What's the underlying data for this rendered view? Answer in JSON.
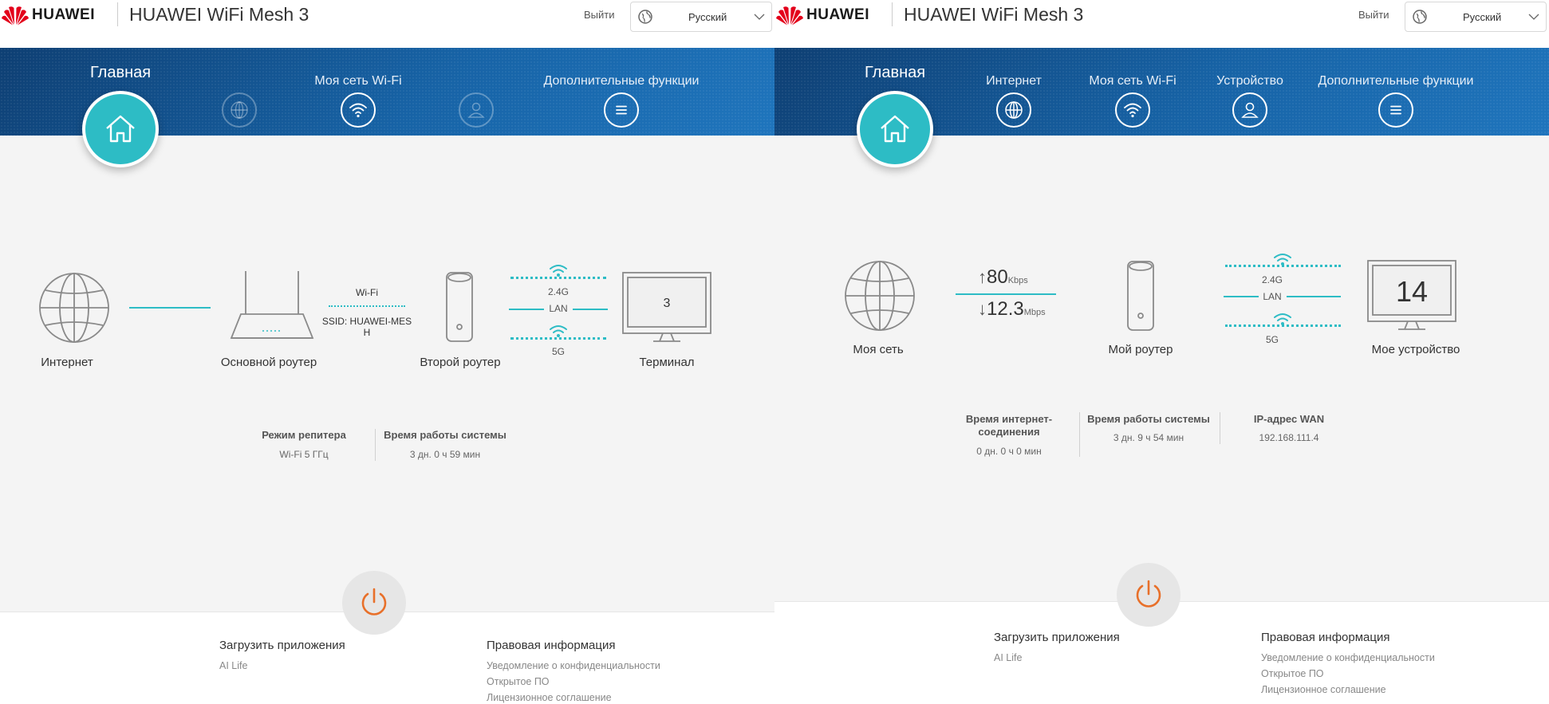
{
  "left": {
    "header": {
      "brand": "HUAWEI",
      "title": "HUAWEI WiFi Mesh 3",
      "logout": "Выйти",
      "language": "Русский"
    },
    "nav": {
      "home": "Главная",
      "wifi": "Моя сеть Wi-Fi",
      "more": "Дополнительные функции"
    },
    "topology": {
      "internet": "Интернет",
      "main_router": "Основной роутер",
      "wifi_label": "Wi-Fi",
      "ssid": "SSID: HUAWEI-MESH",
      "second_router": "Второй роутер",
      "band_24": "2.4G",
      "lan": "LAN",
      "band_5": "5G",
      "terminal": "Терминал",
      "terminal_count": "3"
    },
    "stats": [
      {
        "title": "Режим репитера",
        "value": "Wi-Fi 5 ГГц"
      },
      {
        "title": "Время работы системы",
        "value": "3 дн. 0 ч 59 мин"
      }
    ],
    "footer": {
      "apps_title": "Загрузить приложения",
      "apps_link": "AI Life",
      "legal_title": "Правовая информация",
      "legal_links": [
        "Уведомление о конфиденциальности",
        "Открытое ПО",
        "Лицензионное соглашение"
      ]
    }
  },
  "right": {
    "header": {
      "brand": "HUAWEI",
      "title": "HUAWEI WiFi Mesh 3",
      "logout": "Выйти",
      "language": "Русский"
    },
    "nav": {
      "home": "Главная",
      "internet": "Интернет",
      "wifi": "Моя сеть Wi-Fi",
      "device": "Устройство",
      "more": "Дополнительные функции"
    },
    "topology": {
      "my_network": "Моя сеть",
      "upload_value": "80",
      "upload_unit": "Kbps",
      "download_value": "12.3",
      "download_unit": "Mbps",
      "my_router": "Мой роутер",
      "band_24": "2.4G",
      "lan": "LAN",
      "band_5": "5G",
      "my_device": "Мое устройство",
      "device_count": "14"
    },
    "stats": [
      {
        "title_line1": "Время интернет-",
        "title_line2": "соединения",
        "value": "0 дн. 0 ч 0 мин"
      },
      {
        "title": "Время работы системы",
        "value": "3 дн. 9 ч 54 мин"
      },
      {
        "title": "IP-адрес WAN",
        "value": "192.168.111.4"
      }
    ],
    "footer": {
      "apps_title": "Загрузить приложения",
      "apps_link": "AI Life",
      "legal_title": "Правовая информация",
      "legal_links": [
        "Уведомление о конфиденциальности",
        "Открытое ПО",
        "Лицензионное соглашение"
      ]
    }
  },
  "colors": {
    "accent": "#2dbcc5",
    "nav_dark": "#0e3f73",
    "nav_light": "#1f75bd",
    "power": "#e8702a",
    "brand_red": "#e3001b"
  }
}
